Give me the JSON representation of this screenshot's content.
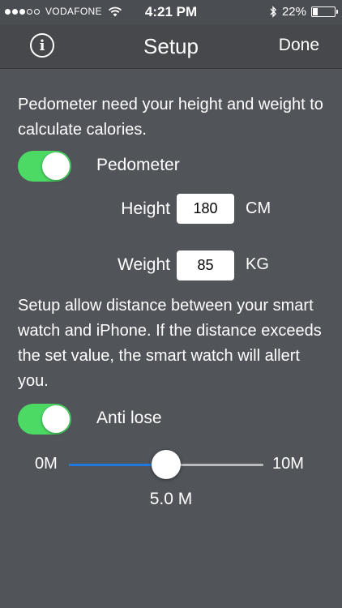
{
  "status_bar": {
    "carrier": "VODAFONE",
    "time": "4:21 PM",
    "battery_percent": "22%",
    "battery_level": 0.22,
    "signal_bars_filled": 3,
    "signal_bars_total": 5,
    "icons": [
      "wifi-icon",
      "bluetooth-icon",
      "battery-icon"
    ]
  },
  "nav": {
    "info_icon": "info-icon",
    "info_glyph": "i",
    "title": "Setup",
    "done_label": "Done"
  },
  "pedometer": {
    "description": "Pedometer need your height and weight to calculate calories.",
    "toggle_label": "Pedometer",
    "toggle_on": true,
    "height_label": "Height",
    "height_value": "180",
    "height_unit": "CM",
    "weight_label": "Weight",
    "weight_value": "85",
    "weight_unit": "KG"
  },
  "anti_lose": {
    "description": "Setup allow distance between your smart watch and iPhone. If the distance exceeds the set value, the smart watch will allert you.",
    "toggle_label": "Anti lose",
    "toggle_on": true,
    "slider_min_label": "0M",
    "slider_max_label": "10M",
    "slider_min": 0,
    "slider_max": 10,
    "slider_value": 5.0,
    "slider_value_label": "5.0 M"
  },
  "colors": {
    "toggle_on": "#4cd964",
    "slider_fill": "#1f7ae0",
    "background": "#515459",
    "navbar": "#46484c"
  }
}
